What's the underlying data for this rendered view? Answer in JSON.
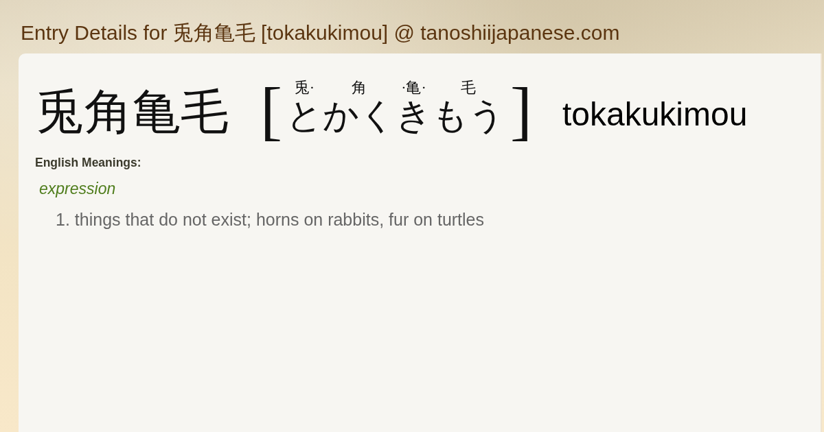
{
  "page": {
    "title": "Entry Details for 兎角亀毛 [tokakukimou] @ tanoshiijapanese.com"
  },
  "entry": {
    "headword": "兎角亀毛",
    "bracket_open": "[",
    "segments": [
      {
        "furigana": "兎·",
        "kana": "と"
      },
      {
        "furigana": "角",
        "kana": "かく"
      },
      {
        "furigana": "·亀·",
        "kana": "き"
      },
      {
        "furigana": "毛",
        "kana": "もう"
      }
    ],
    "bracket_close": "]",
    "romaji": "tokakukimou"
  },
  "meanings": {
    "heading": "English Meanings:",
    "groups": [
      {
        "part_of_speech": "expression",
        "senses": [
          {
            "number": "1.",
            "text": "things that do not exist; horns on rabbits, fur on turtles"
          }
        ]
      }
    ]
  }
}
